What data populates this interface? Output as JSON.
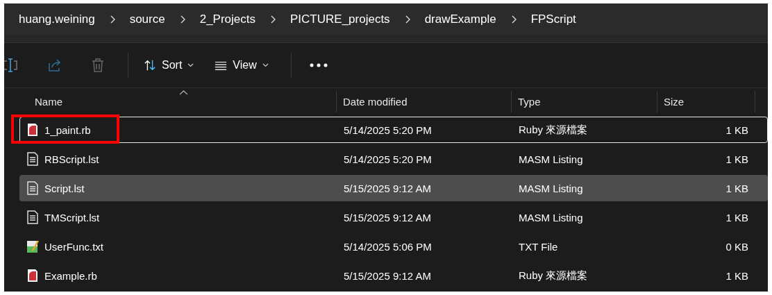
{
  "breadcrumbs": [
    "huang.weining",
    "source",
    "2_Projects",
    "PICTURE_projects",
    "drawExample",
    "FPScript"
  ],
  "toolbar": {
    "sort": "Sort",
    "view": "View"
  },
  "table": {
    "columns": [
      {
        "label": "Name",
        "sorted": true
      },
      {
        "label": "Date modified",
        "sorted": false
      },
      {
        "label": "Type",
        "sorted": false
      },
      {
        "label": "Size",
        "sorted": false
      }
    ],
    "rows": [
      {
        "kind": "ruby",
        "name": "1_paint.rb",
        "date": "5/14/2025 5:20 PM",
        "type": "Ruby 來源檔案",
        "size": "1 KB",
        "focused": true,
        "selected": false,
        "annotated": true
      },
      {
        "kind": "listing",
        "name": "RBScript.lst",
        "date": "5/14/2025 5:20 PM",
        "type": "MASM Listing",
        "size": "1 KB",
        "focused": false,
        "selected": false,
        "annotated": false
      },
      {
        "kind": "listing",
        "name": "Script.lst",
        "date": "5/15/2025 9:12 AM",
        "type": "MASM Listing",
        "size": "1 KB",
        "focused": false,
        "selected": true,
        "annotated": false
      },
      {
        "kind": "listing",
        "name": "TMScript.lst",
        "date": "5/15/2025 9:12 AM",
        "type": "MASM Listing",
        "size": "1 KB",
        "focused": false,
        "selected": false,
        "annotated": false
      },
      {
        "kind": "text",
        "name": "UserFunc.txt",
        "date": "5/14/2025 5:06 PM",
        "type": "TXT File",
        "size": "0 KB",
        "focused": false,
        "selected": false,
        "annotated": false
      },
      {
        "kind": "ruby",
        "name": "Example.rb",
        "date": "5/15/2025 9:12 AM",
        "type": "Ruby 來源檔案",
        "size": "1 KB",
        "focused": false,
        "selected": false,
        "annotated": false
      }
    ]
  }
}
